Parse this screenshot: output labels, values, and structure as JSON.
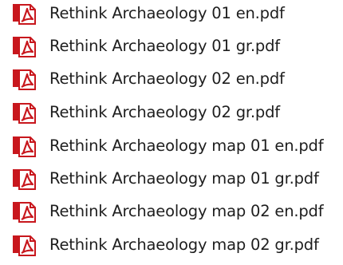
{
  "files": [
    {
      "name": "Rethink Archaeology 01 en.pdf",
      "icon": "pdf-file-icon"
    },
    {
      "name": "Rethink Archaeology 01 gr.pdf",
      "icon": "pdf-file-icon"
    },
    {
      "name": "Rethink Archaeology 02 en.pdf",
      "icon": "pdf-file-icon"
    },
    {
      "name": "Rethink Archaeology 02 gr.pdf",
      "icon": "pdf-file-icon"
    },
    {
      "name": "Rethink Archaeology map 01 en.pdf",
      "icon": "pdf-file-icon"
    },
    {
      "name": "Rethink Archaeology map 01 gr.pdf",
      "icon": "pdf-file-icon"
    },
    {
      "name": "Rethink Archaeology map 02 en.pdf",
      "icon": "pdf-file-icon"
    },
    {
      "name": "Rethink Archaeology map 02 gr.pdf",
      "icon": "pdf-file-icon"
    }
  ],
  "colors": {
    "icon_red": "#c8171d",
    "icon_page": "#ffffff",
    "text": "#1e1e1e"
  }
}
